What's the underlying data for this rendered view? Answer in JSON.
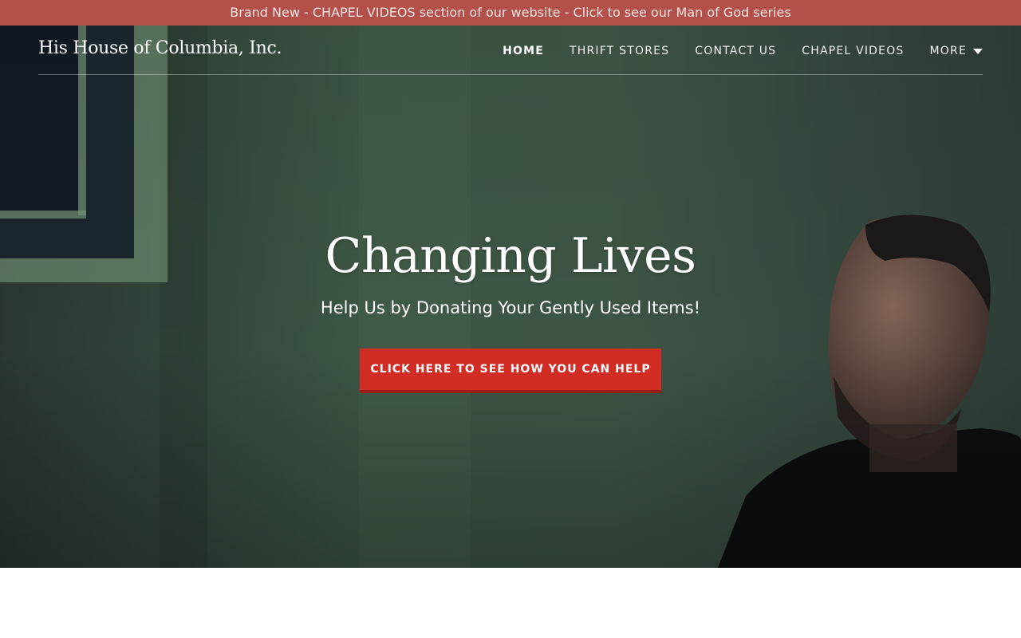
{
  "announcement": {
    "text": "Brand New - CHAPEL VIDEOS section of our website - Click to see our Man of God series"
  },
  "header": {
    "site_title": "His House of Columbia, Inc.",
    "nav": [
      {
        "label": "HOME",
        "active": true
      },
      {
        "label": "THRIFT STORES",
        "active": false
      },
      {
        "label": "CONTACT US",
        "active": false
      },
      {
        "label": "CHAPEL VIDEOS",
        "active": false
      },
      {
        "label": "MORE",
        "active": false,
        "icon": "caret-down-icon"
      }
    ]
  },
  "hero": {
    "title": "Changing Lives",
    "subtitle": "Help Us by Donating Your Gently Used Items!",
    "cta_label": "CLICK HERE TO SEE HOW YOU CAN HELP"
  },
  "colors": {
    "announcement_bar": "#b3504a",
    "cta_button": "#d22d24",
    "hero_overlay": "#34463c"
  }
}
